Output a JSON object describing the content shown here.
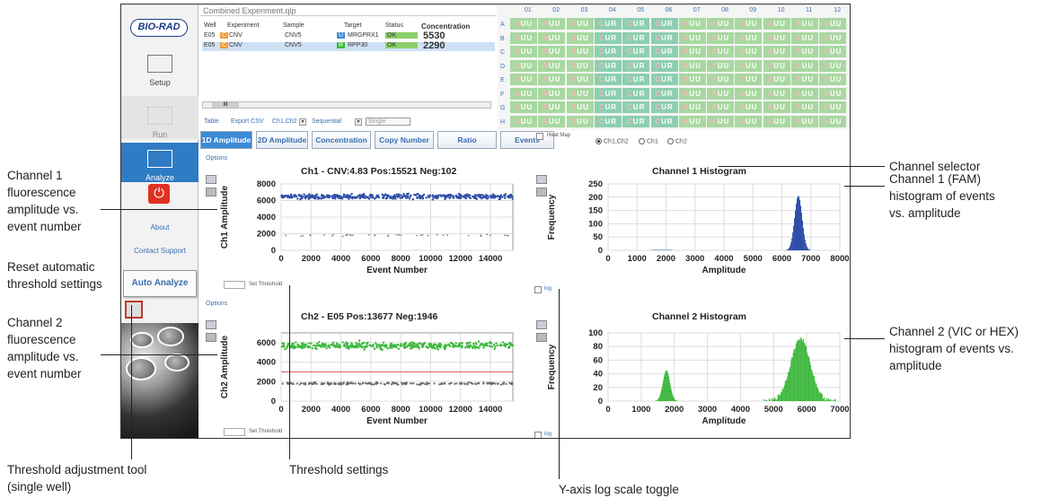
{
  "callouts": {
    "channel_selector": "Channel selector",
    "ch1_hist": [
      "Channel 1 (FAM)",
      "histogram of events",
      "vs. amplitude"
    ],
    "ch2_hist": [
      "Channel 2 (VIC or HEX)",
      "histogram of events vs.",
      "amplitude"
    ],
    "ch1_amp": [
      "Channel 1",
      "fluorescence",
      "amplitude vs.",
      "event number"
    ],
    "reset": [
      "Reset automatic",
      "threshold settings"
    ],
    "ch2_amp": [
      "Channel 2",
      "fluorescence",
      "amplitude vs.",
      "event number"
    ],
    "threshold_tool": [
      "Threshold adjustment tool",
      "(single well)"
    ],
    "threshold_settings": "Threshold settings",
    "ylog": "Y-axis log scale toggle"
  },
  "sidebar": {
    "logo": "BIO-RAD",
    "setup": "Setup",
    "run": "Run",
    "analyze": "Analyze",
    "about": "About",
    "contact": "Contact Support",
    "auto_analyze": "Auto Analyze"
  },
  "table": {
    "title": "Combined Experiment.qlp",
    "headers": [
      "Well",
      "Experiment",
      "Sample",
      "Target",
      "Status",
      "Concentration"
    ],
    "rows": [
      {
        "well": "E05",
        "exp_icon": "C",
        "experiment": "CNV",
        "sample": "CNV5",
        "target_icon": "U",
        "target": "MRGPRX1",
        "status": "OK",
        "concentration": "5530"
      },
      {
        "well": "E05",
        "exp_icon": "C",
        "experiment": "CNV",
        "sample": "CNV5",
        "target_icon": "R",
        "target": "RPP30",
        "status": "OK",
        "concentration": "2290"
      }
    ],
    "bar": {
      "table": "Table",
      "export": "Export CSV",
      "channels": "Ch1,Ch2",
      "order": "Sequential",
      "mode": "Single"
    },
    "scroll_label": "III"
  },
  "plate": {
    "cols": [
      "01",
      "02",
      "03",
      "04",
      "05",
      "06",
      "07",
      "08",
      "09",
      "10",
      "11",
      "12"
    ],
    "rows": [
      "A",
      "B",
      "C",
      "D",
      "E",
      "F",
      "G",
      "H"
    ],
    "well_codes": {
      "A": [
        "UU",
        "UU",
        "UU",
        "UR",
        "UR",
        "UR",
        "UU",
        "UU",
        "UU",
        "UU",
        "UU",
        "UU"
      ],
      "B": [
        "UU",
        "UU",
        "UU",
        "UR",
        "UR",
        "UR",
        "UU",
        "UU",
        "UU",
        "UU",
        "UU",
        "UU"
      ],
      "C": [
        "UU",
        "UU",
        "UU",
        "UR",
        "UR",
        "UR",
        "UU",
        "UU",
        "UU",
        "UU",
        "UU",
        "UU"
      ],
      "D": [
        "UU",
        "UU",
        "UU",
        "UR",
        "UR",
        "UR",
        "UU",
        "UU",
        "UU",
        "UU",
        "UU",
        "UU"
      ],
      "E": [
        "UU",
        "UU",
        "UU",
        "UR",
        "UR",
        "UR",
        "UU",
        "UU",
        "UU",
        "UU",
        "UU",
        "UU"
      ],
      "F": [
        "UU",
        "UU",
        "UU",
        "UR",
        "UR",
        "UR",
        "UU",
        "UU",
        "UU",
        "UU",
        "UU",
        "UU"
      ],
      "G": [
        "UU",
        "UU",
        "UU",
        "UR",
        "UR",
        "UR",
        "UU",
        "UU",
        "UU",
        "UU",
        "UU",
        "UU"
      ],
      "H": [
        "UU",
        "UU",
        "UU",
        "UR",
        "UR",
        "UR",
        "UU",
        "UU",
        "UU",
        "UU",
        "UU",
        "UU"
      ]
    },
    "well_prefix": {
      "A": [
        "A",
        "R",
        "R",
        "C",
        "C",
        "C",
        "A",
        "A",
        "A",
        "A",
        "A",
        "A"
      ]
    },
    "selected_well": "E05"
  },
  "tabs": [
    "1D Amplitude",
    "2D Amplitude",
    "Concentration",
    "Copy Number",
    "Ratio",
    "Events"
  ],
  "heat_map": "Heat Map",
  "channel_options": [
    "Ch1,Ch2",
    "Ch1",
    "Ch2"
  ],
  "options_label": "Options",
  "set_threshold": "Set Threshold",
  "log_label": "log",
  "plots": {
    "ch1": {
      "title": "Ch1 - CNV:4.83 Pos:15521 Neg:102",
      "ylabel": "Ch1 Amplitude",
      "xlabel": "Event Number",
      "yticks": [
        "0",
        "2000",
        "4000",
        "6000",
        "8000"
      ],
      "xticks": [
        "0",
        "2000",
        "4000",
        "6000",
        "8000",
        "10000",
        "12000",
        "14000"
      ]
    },
    "ch1_hist": {
      "title": "Channel 1 Histogram",
      "ylabel": "Frequency",
      "xlabel": "Amplitude",
      "yticks": [
        "0",
        "50",
        "100",
        "150",
        "200",
        "250"
      ],
      "xticks": [
        "0",
        "1000",
        "2000",
        "3000",
        "4000",
        "5000",
        "6000",
        "7000",
        "8000"
      ]
    },
    "ch2": {
      "title": "Ch2 - E05 Pos:13677 Neg:1946",
      "ylabel": "Ch2 Amplitude",
      "xlabel": "Event Number",
      "yticks": [
        "0",
        "2000",
        "4000",
        "6000"
      ],
      "xticks": [
        "0",
        "2000",
        "4000",
        "6000",
        "8000",
        "10000",
        "12000",
        "14000"
      ]
    },
    "ch2_hist": {
      "title": "Channel 2 Histogram",
      "ylabel": "Frequency",
      "xlabel": "Amplitude",
      "yticks": [
        "0",
        "20",
        "40",
        "60",
        "80",
        "100"
      ],
      "xticks": [
        "0",
        "1000",
        "2000",
        "3000",
        "4000",
        "5000",
        "6000",
        "7000"
      ]
    }
  },
  "colors": {
    "blue": "#2f4fa8",
    "green": "#3cb83c",
    "gray": "#6a6a6a",
    "accent": "#3b6fb0"
  }
}
